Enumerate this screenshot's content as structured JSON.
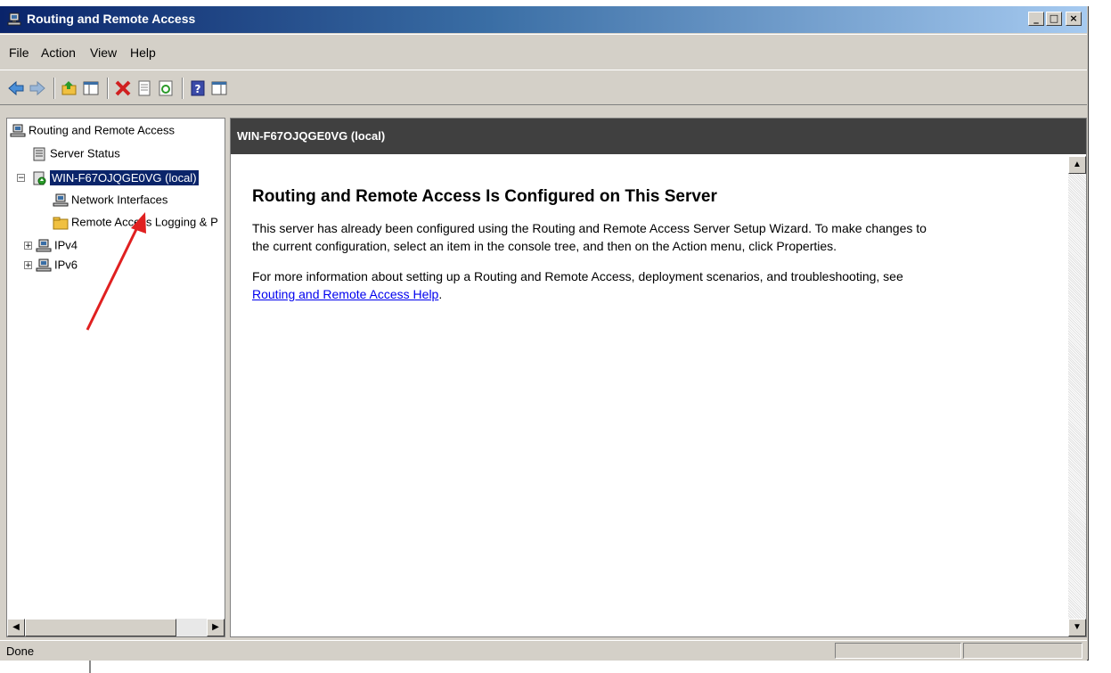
{
  "window": {
    "title": "Routing and Remote Access",
    "controls": [
      "_",
      "□",
      "×"
    ]
  },
  "menubar": {
    "items": [
      "File",
      "Action",
      "View",
      "Help"
    ]
  },
  "toolbar": {
    "buttons": [
      "back-icon",
      "forward-icon",
      "up-folder-icon",
      "show-hide-tree-icon",
      "delete-icon",
      "properties-icon",
      "refresh-icon",
      "help-icon",
      "action-pane-icon"
    ]
  },
  "tree": {
    "root": "Routing and Remote Access",
    "server_status": "Server Status",
    "server": "WIN-F67OJQGE0VG (local)",
    "network_interfaces": "Network Interfaces",
    "remote_logging": "Remote Access Logging & P",
    "ipv4": "IPv4",
    "ipv6": "IPv6"
  },
  "main": {
    "header": "WIN-F67OJQGE0VG (local)",
    "title": "Routing and Remote Access Is Configured on This Server",
    "para1_line1": "This server has already been configured using the Routing and Remote Access Server Setup Wizard. To make changes to",
    "para1_line2": "the current configuration, select an item in the console tree, and then on the Action menu, click Properties.",
    "para2_line1": "For more information about setting up a Routing and Remote Access, deployment scenarios, and troubleshooting, see",
    "help_link": "Routing and Remote Access Help",
    "help_link_suffix": "."
  },
  "statusbar": {
    "text": "Done"
  },
  "colors": {
    "titlebar_start": "#0a246a",
    "selection": "#0a246a",
    "header_bg": "#404040",
    "arrow": "#e02020"
  }
}
